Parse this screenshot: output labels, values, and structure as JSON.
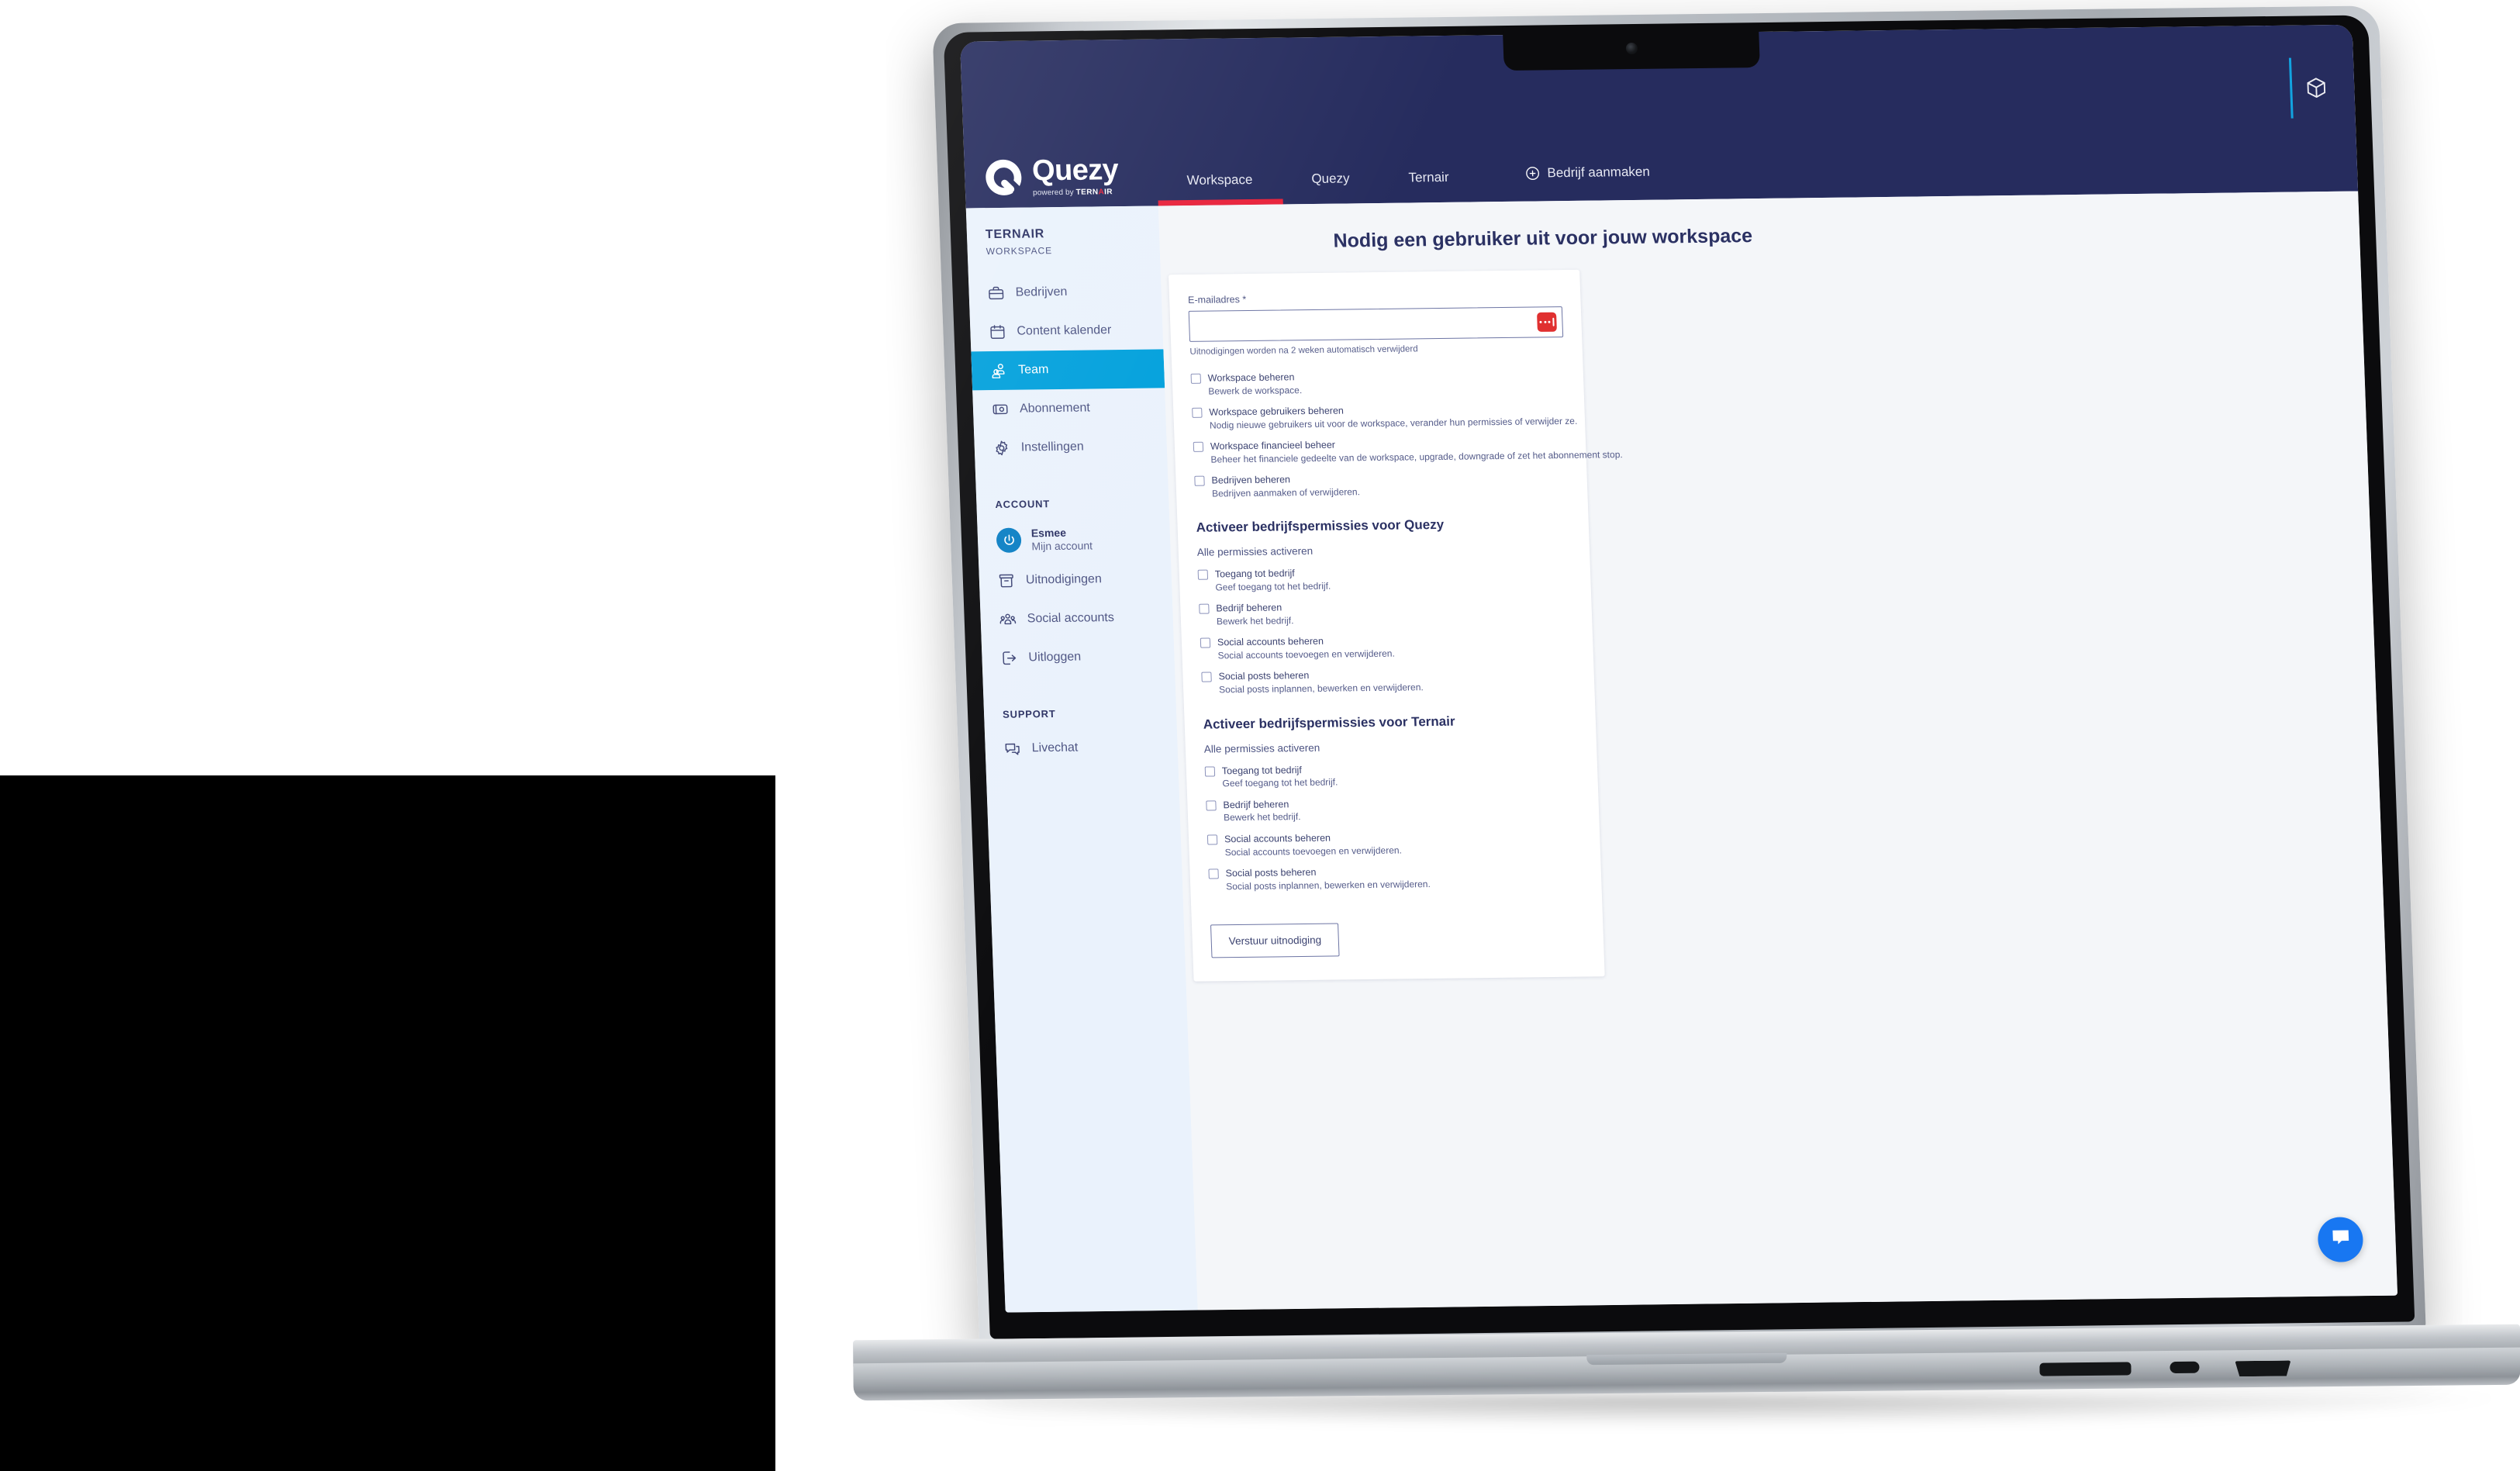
{
  "device": {
    "type": "laptop-macbook-pro",
    "ports": [
      "sd-card-slot",
      "usb-c-port",
      "hdmi-port"
    ]
  },
  "topbar": {
    "brand": {
      "name": "Quezy",
      "powered_prefix": "powered by ",
      "powered_brand_a": "TERN",
      "powered_brand_dot": "A",
      "powered_brand_b": "IR"
    },
    "tabs": [
      {
        "label": "Workspace",
        "active": true
      },
      {
        "label": "Quezy",
        "active": false
      },
      {
        "label": "Ternair",
        "active": false
      }
    ],
    "create_button": "Bedrijf aanmaken",
    "accent_red": "#e8213a",
    "navy": "#262c5e",
    "cyan": "#12a3e0"
  },
  "sidebar": {
    "workspace_name": "TERNAIR",
    "workspace_sub": "WORKSPACE",
    "items": [
      {
        "label": "Bedrijven",
        "icon": "briefcase-icon",
        "active": false
      },
      {
        "label": "Content kalender",
        "icon": "calendar-icon",
        "active": false
      },
      {
        "label": "Team",
        "icon": "users-icon",
        "active": true
      },
      {
        "label": "Abonnement",
        "icon": "banknote-icon",
        "active": false
      },
      {
        "label": "Instellingen",
        "icon": "gear-icon",
        "active": false
      }
    ],
    "account_label": "ACCOUNT",
    "account": {
      "name": "Esmee",
      "subtitle": "Mijn account",
      "icon": "power-avatar-icon"
    },
    "account_items": [
      {
        "label": "Uitnodigingen",
        "icon": "archive-icon"
      },
      {
        "label": "Social accounts",
        "icon": "people-group-icon"
      },
      {
        "label": "Uitloggen",
        "icon": "logout-icon"
      }
    ],
    "support_label": "SUPPORT",
    "support_items": [
      {
        "label": "Livechat",
        "icon": "chat-icon"
      }
    ],
    "active_color": "#00a0dc",
    "background": "#eaf2fc"
  },
  "main": {
    "page_title": "Nodig een gebruiker uit voor jouw workspace",
    "email": {
      "label": "E-mailadres",
      "required_mark": "*",
      "value": "",
      "placeholder": "",
      "hint": "Uitnodigingen worden na 2 weken automatisch verwijderd",
      "password_manager_icon": "password-manager-icon"
    },
    "workspace_permissions": [
      {
        "title": "Workspace beheren",
        "desc": "Bewerk de workspace.",
        "checked": false
      },
      {
        "title": "Workspace gebruikers beheren",
        "desc": "Nodig nieuwe gebruikers uit voor de workspace, verander hun permissies of verwijder ze.",
        "checked": false
      },
      {
        "title": "Workspace financieel beheer",
        "desc": "Beheer het financiele gedeelte van de workspace, upgrade, downgrade of zet het abonnement stop.",
        "checked": false
      },
      {
        "title": "Bedrijven beheren",
        "desc": "Bedrijven aanmaken of verwijderen.",
        "checked": false
      }
    ],
    "company_sections": [
      {
        "heading": "Activeer bedrijfspermissies voor Quezy",
        "toggle_all": "Alle permissies activeren",
        "permissions": [
          {
            "title": "Toegang tot bedrijf",
            "desc": "Geef toegang tot het bedrijf.",
            "checked": false
          },
          {
            "title": "Bedrijf beheren",
            "desc": "Bewerk het bedrijf.",
            "checked": false
          },
          {
            "title": "Social accounts beheren",
            "desc": "Social accounts toevoegen en verwijderen.",
            "checked": false
          },
          {
            "title": "Social posts beheren",
            "desc": "Social posts inplannen, bewerken en verwijderen.",
            "checked": false
          }
        ]
      },
      {
        "heading": "Activeer bedrijfspermissies voor Ternair",
        "toggle_all": "Alle permissies activeren",
        "permissions": [
          {
            "title": "Toegang tot bedrijf",
            "desc": "Geef toegang tot het bedrijf.",
            "checked": false
          },
          {
            "title": "Bedrijf beheren",
            "desc": "Bewerk het bedrijf.",
            "checked": false
          },
          {
            "title": "Social accounts beheren",
            "desc": "Social accounts toevoegen en verwijderen.",
            "checked": false
          },
          {
            "title": "Social posts beheren",
            "desc": "Social posts inplannen, bewerken en verwijderen.",
            "checked": false
          }
        ]
      }
    ],
    "submit_button": "Verstuur uitnodiging"
  },
  "chat_widget": {
    "icon": "chat-bubble-icon",
    "color": "#1877f2"
  }
}
